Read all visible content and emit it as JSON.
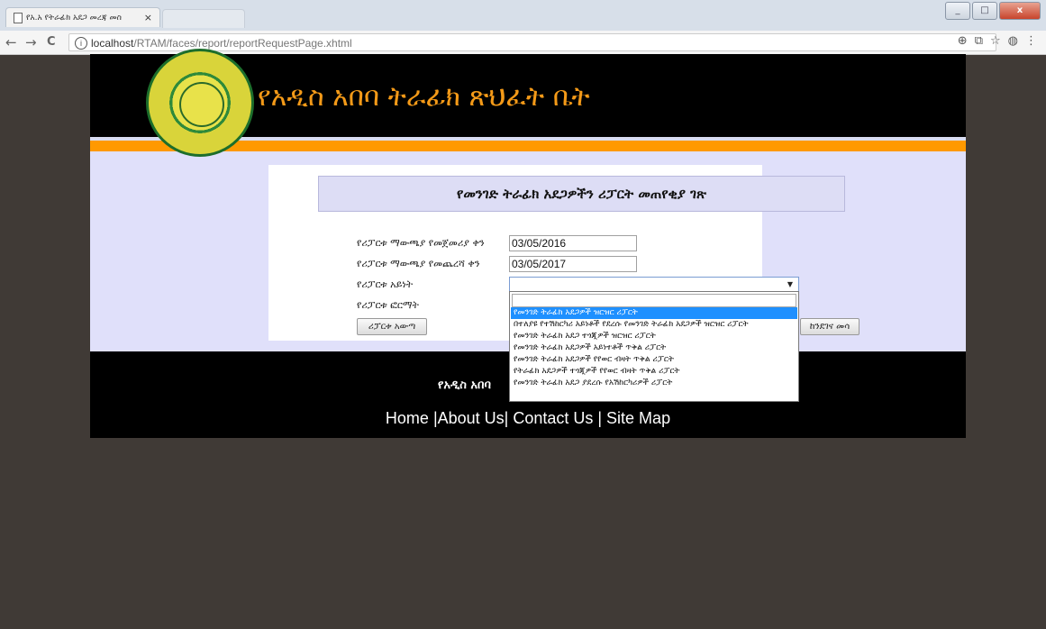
{
  "browser": {
    "tab_title": "የአ.አ የትራፊክ አደጋ መረጃ መስ",
    "tab_close": "×",
    "url_host": "localhost",
    "url_path": "/RTAM/faces/report/reportRequestPage.xhtml",
    "nav_back": "←",
    "nav_forward": "→",
    "nav_reload": "C",
    "info_glyph": "i",
    "zoom_icon": "⊕",
    "translate_icon": "⧉",
    "star_icon": "☆",
    "ext_icon": "◍",
    "menu_icon": "⋮",
    "win_min": "_",
    "win_max": "□",
    "win_close": "x"
  },
  "header": {
    "site_title": "የአዲስ አበባ ትራፊክ ጽህፈት ቤት"
  },
  "form": {
    "page_title": "የመንገድ ትራፊክ አደጋዎችን ሪፓርት መጠየቂያ ገጽ",
    "start_label": "የሪፓርቱ ማውጫያ የመጀመሪያ ቀን",
    "start_value": "03/05/2016",
    "end_label": "የሪፓርቱ ማውጫያ የመጨረሻ ቀን",
    "end_value": "03/05/2017",
    "type_label": "የሪፓርቱ አይነት",
    "format_label": "የሪፓርቱ ፎርማት",
    "submit_button": "ሪፓርቱ አውጣ",
    "back_button": "ከንደገና መሳ"
  },
  "dropdown": {
    "selected_index": 0,
    "options": [
      "የመንገድ ትራፊክ አደጋዎች ዝርዝር ሪፓርት",
      "በተለያዩ የተሽከርካሪ አይነቶች የደረሱ የመንገድ ትራፊክ አደጋዎች ዝርዝር ሪፓርት",
      "የመንገድ ትራፊክ አደጋ ተጎጂዎች ዝርዝር ሪፓርት",
      "የመንገድ ትራፊክ አደጋዎች አይነተቶች ጥቅል ሪፓርት",
      "የመንገድ ትራፊክ አደጋዎች የየወር ብዛት ጥቅል ሪፓርት",
      "የትራፊክ አደጋዎች ተጎጂዎች የየወር ብዛት ጥቅል ሪፓርት",
      "የመንገድ ትራፊክ አደጋ ያደረሱ የአሽከርካሪዎች ሪፓርት"
    ]
  },
  "footer": {
    "title": "የአዲስ አበባ",
    "links": "Home |About Us| Contact Us | Site Map"
  }
}
